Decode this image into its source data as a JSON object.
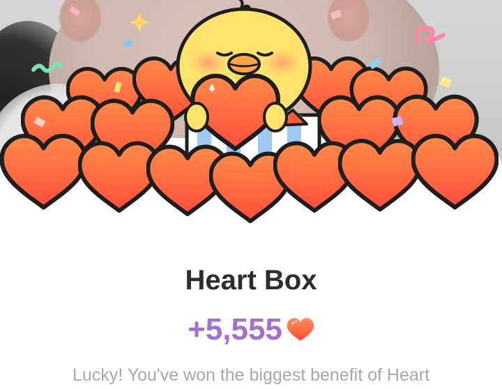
{
  "popup": {
    "title": "Heart Box",
    "amount": "+5,555",
    "message": "Lucky! You've won the biggest benefit of Heart"
  },
  "colors": {
    "amount": "#a46fcf",
    "heart_fill_top": "#ff7a45",
    "heart_fill_bottom": "#ff4a3a",
    "chick_body": "#ffe26a",
    "title": "#2d2d2d",
    "message": "#a8a8a8"
  },
  "icons": {
    "amount_icon": "heart-icon",
    "illustration": "chick-with-hearts-illustration"
  }
}
